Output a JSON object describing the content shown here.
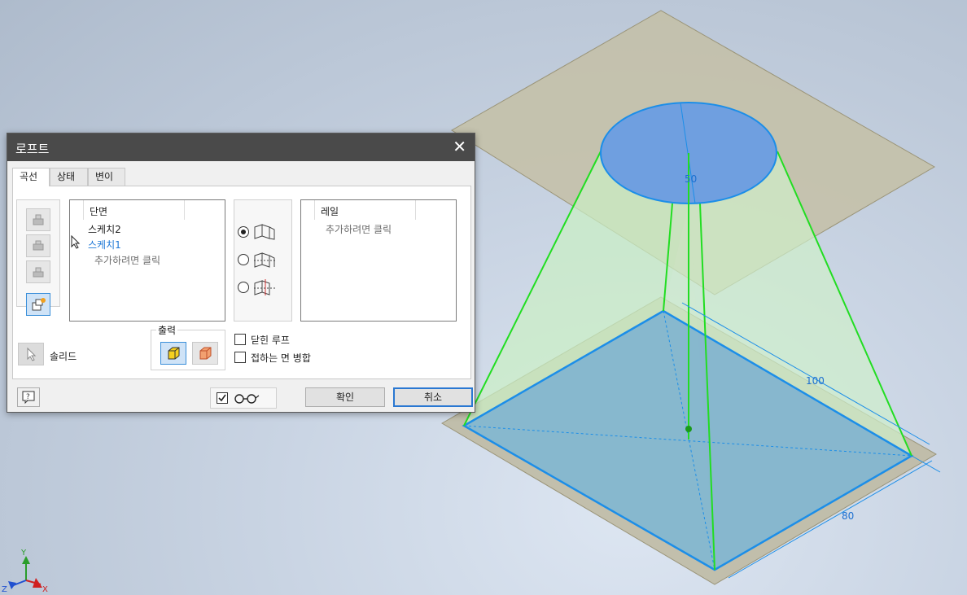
{
  "viewport": {
    "dimensions": {
      "d50": "50",
      "d100": "100",
      "d80": "80"
    },
    "triad": {
      "y": "Y",
      "x": "X",
      "z": "Z"
    }
  },
  "dialog": {
    "title": "로프트",
    "tabs": [
      {
        "label": "곡선",
        "active": true
      },
      {
        "label": "상태",
        "active": false
      },
      {
        "label": "변이",
        "active": false
      }
    ],
    "sections": {
      "header": "단면",
      "items": [
        "스케치2",
        "스케치1"
      ],
      "add_hint": "추가하려면 클릭"
    },
    "rails": {
      "header": "레일",
      "add_hint": "추가하려면 클릭"
    },
    "loft_mode": {
      "options": [
        "rails-loft",
        "center-line-loft",
        "area-loft"
      ],
      "selected": "rails-loft"
    },
    "selection_label": "솔리드",
    "output": {
      "label": "출력",
      "options": [
        "solid",
        "surface"
      ],
      "selected": "solid"
    },
    "checkboxes": [
      {
        "label": "닫힌 루프",
        "checked": false
      },
      {
        "label": "접하는 면 병합",
        "checked": false
      }
    ],
    "preview_checked": true,
    "buttons": {
      "ok": "확인",
      "cancel": "취소"
    }
  },
  "colors": {
    "accent": "#1e78d6",
    "loft_edge": "#22dd22",
    "profile_fill": "#6f9fe0",
    "plane": "#bdb8a0",
    "titlebar": "#4a4a4a"
  }
}
